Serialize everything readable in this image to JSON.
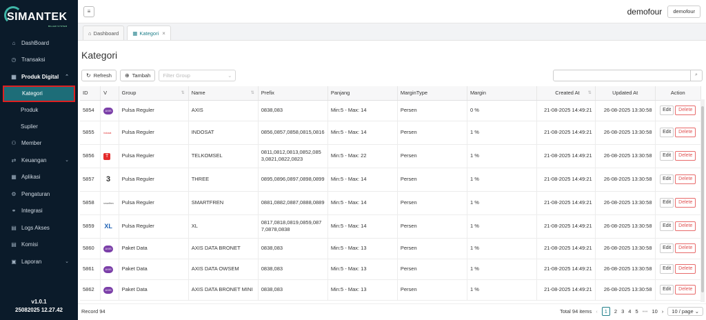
{
  "brand": {
    "name": "SIMANTEK",
    "tagline": "BILLER SYSTEM"
  },
  "sidebar": {
    "items": [
      {
        "label": "DashBoard",
        "icon": "home-icon"
      },
      {
        "label": "Transaksi",
        "icon": "clock-icon"
      },
      {
        "label": "Produk Digital",
        "icon": "grid-icon",
        "expanded": true
      },
      {
        "label": "Member",
        "icon": "users-icon"
      },
      {
        "label": "Keuangan",
        "icon": "money-icon"
      },
      {
        "label": "Aplikasi",
        "icon": "apps-icon"
      },
      {
        "label": "Pengaturan",
        "icon": "gear-icon"
      },
      {
        "label": "Integrasi",
        "icon": "link-icon"
      },
      {
        "label": "Logs Akses",
        "icon": "doc-icon"
      },
      {
        "label": "Komisi",
        "icon": "doc-icon"
      },
      {
        "label": "Laporan",
        "icon": "report-icon"
      }
    ],
    "sub": [
      {
        "label": "Kategori"
      },
      {
        "label": "Produk"
      },
      {
        "label": "Suplier"
      }
    ],
    "version": "v1.0.1",
    "build": "25082025 12.27.42"
  },
  "header": {
    "user": "demofour",
    "user_btn": "demofour"
  },
  "tabs": [
    {
      "label": "Dashboard"
    },
    {
      "label": "Kategori"
    }
  ],
  "page": {
    "title": "Kategori",
    "refresh": "Refresh",
    "add": "Tambah",
    "filter_placeholder": "Filter Group"
  },
  "table": {
    "headers": [
      "ID",
      "V",
      "Group",
      "Name",
      "Prefix",
      "Panjang",
      "MarginType",
      "Margin",
      "Created At",
      "Updated At",
      "Action"
    ],
    "rows": [
      {
        "id": "5854",
        "logo": "AXIS",
        "group": "Pulsa Reguler",
        "name": "AXIS",
        "prefix": "0838,083",
        "panjang": "Min:5 - Max: 14",
        "mtype": "Persen",
        "margin": "0 %",
        "created": "21-08-2025 14:49:21",
        "updated": "26-08-2025 13:30:58"
      },
      {
        "id": "5855",
        "logo": "indosat",
        "group": "Pulsa Reguler",
        "name": "INDOSAT",
        "prefix": "0856,0857,0858,0815,0816",
        "panjang": "Min:5 - Max: 14",
        "mtype": "Persen",
        "margin": "1 %",
        "created": "21-08-2025 14:49:21",
        "updated": "26-08-2025 13:30:58"
      },
      {
        "id": "5856",
        "logo": "T",
        "group": "Pulsa Reguler",
        "name": "TELKOMSEL",
        "prefix": "0811,0812,0813,0852,0853,0821,0822,0823",
        "panjang": "Min:5 - Max: 22",
        "mtype": "Persen",
        "margin": "1 %",
        "created": "21-08-2025 14:49:21",
        "updated": "26-08-2025 13:30:58"
      },
      {
        "id": "5857",
        "logo": "3",
        "group": "Pulsa Reguler",
        "name": "THREE",
        "prefix": "0895,0896,0897,0898,0899",
        "panjang": "Min:5 - Max: 14",
        "mtype": "Persen",
        "margin": "1 %",
        "created": "21-08-2025 14:49:21",
        "updated": "26-08-2025 13:30:58"
      },
      {
        "id": "5858",
        "logo": "smartfren",
        "group": "Pulsa Reguler",
        "name": "SMARTFREN",
        "prefix": "0881,0882,0887,0888,0889",
        "panjang": "Min:5 - Max: 14",
        "mtype": "Persen",
        "margin": "1 %",
        "created": "21-08-2025 14:49:21",
        "updated": "26-08-2025 13:30:58"
      },
      {
        "id": "5859",
        "logo": "XL",
        "group": "Pulsa Reguler",
        "name": "XL",
        "prefix": "0817,0818,0819,0859,0877,0878,0838",
        "panjang": "Min:5 - Max: 14",
        "mtype": "Persen",
        "margin": "1 %",
        "created": "21-08-2025 14:49:21",
        "updated": "26-08-2025 13:30:58"
      },
      {
        "id": "5860",
        "logo": "AXIS",
        "group": "Paket Data",
        "name": "AXIS DATA BRONET",
        "prefix": "0838,083",
        "panjang": "Min:5 - Max: 13",
        "mtype": "Persen",
        "margin": "1 %",
        "created": "21-08-2025 14:49:21",
        "updated": "26-08-2025 13:30:58"
      },
      {
        "id": "5861",
        "logo": "AXIS",
        "group": "Paket Data",
        "name": "AXIS DATA OWSEM",
        "prefix": "0838,083",
        "panjang": "Min:5 - Max: 13",
        "mtype": "Persen",
        "margin": "1 %",
        "created": "21-08-2025 14:49:21",
        "updated": "26-08-2025 13:30:58"
      },
      {
        "id": "5862",
        "logo": "AXIS",
        "group": "Paket Data",
        "name": "AXIS DATA BRONET MINI",
        "prefix": "0838,083",
        "panjang": "Min:5 - Max: 13",
        "mtype": "Persen",
        "margin": "1 %",
        "created": "21-08-2025 14:49:21",
        "updated": "26-08-2025 13:30:58"
      }
    ],
    "edit": "Edit",
    "delete": "Delete"
  },
  "footer": {
    "record": "Record 94",
    "total": "Total 94 items",
    "pages": [
      "1",
      "2",
      "3",
      "4",
      "5",
      "•••",
      "10"
    ],
    "per_page": "10 / page"
  },
  "colors": {
    "sidebar": "#0b1b2a",
    "accent": "#1f7f8a",
    "danger": "#e05252"
  }
}
